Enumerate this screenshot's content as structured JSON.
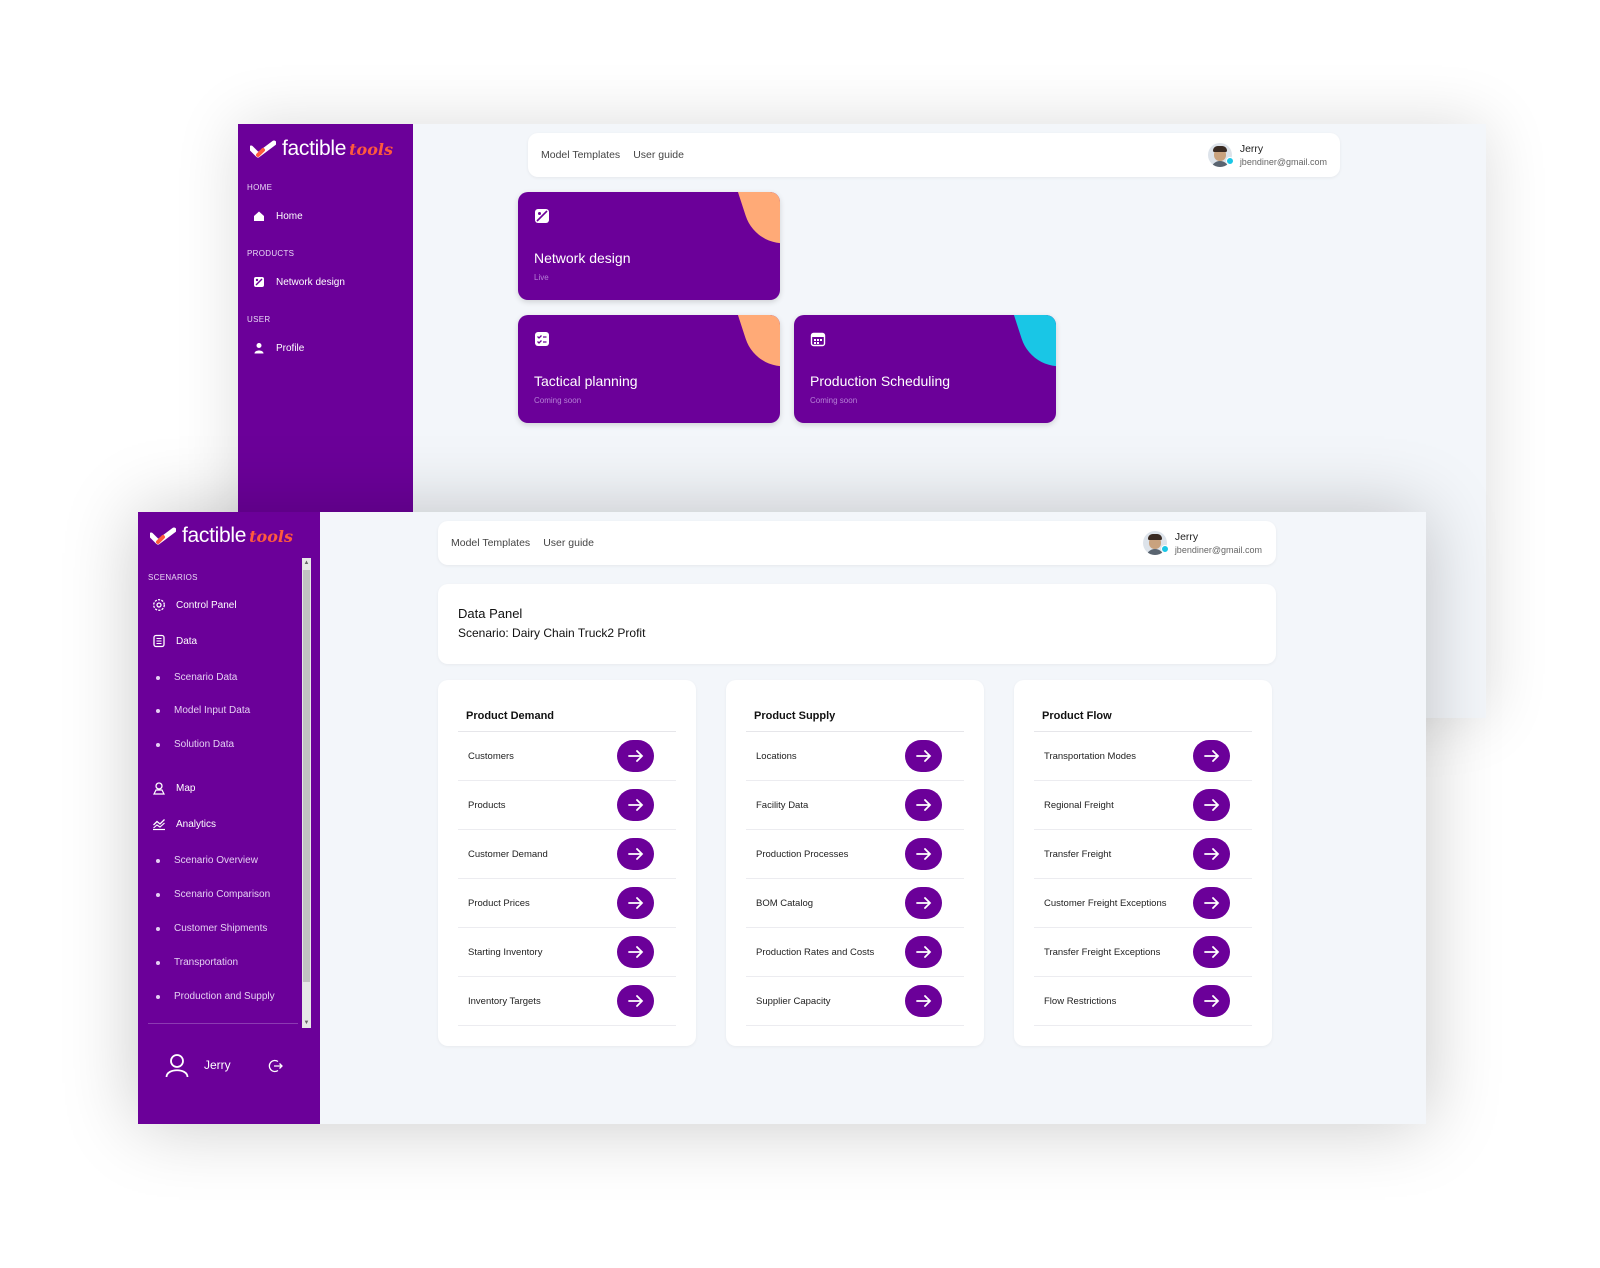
{
  "colors": {
    "purple": "#6b0099",
    "orange_accent": "#ffaa77",
    "cyan_accent": "#19c6e6",
    "logo_tools": "#ff5a3c"
  },
  "brand": {
    "word": "factible",
    "tools": "tools"
  },
  "topbar": {
    "links": [
      "Model Templates",
      "User guide"
    ]
  },
  "user": {
    "name": "Jerry",
    "email": "jbendiner@gmail.com"
  },
  "back": {
    "sections": [
      {
        "label": "HOME",
        "items": [
          {
            "label": "Home",
            "icon": "home-icon"
          }
        ]
      },
      {
        "label": "PRODUCTS",
        "items": [
          {
            "label": "Network design",
            "icon": "network-icon"
          }
        ]
      },
      {
        "label": "USER",
        "items": [
          {
            "label": "Profile",
            "icon": "person-icon"
          }
        ]
      }
    ],
    "cards": [
      {
        "title": "Network design",
        "status": "Live",
        "icon": "image-edit-icon",
        "accent": "orange"
      },
      {
        "title": "Tactical planning",
        "status": "Coming soon",
        "icon": "checklist-icon",
        "accent": "orange"
      },
      {
        "title": "Production Scheduling",
        "status": "Coming soon",
        "icon": "calendar-icon",
        "accent": "cyan"
      }
    ]
  },
  "front": {
    "section_label": "SCENARIOS",
    "nav": [
      {
        "label": "Control Panel",
        "icon": "gear-icon"
      },
      {
        "label": "Data",
        "icon": "database-icon"
      },
      {
        "label": "Scenario Data",
        "sub": true
      },
      {
        "label": "Model Input Data",
        "sub": true
      },
      {
        "label": "Solution Data",
        "sub": true
      },
      {
        "label": "Map",
        "icon": "map-pin-icon"
      },
      {
        "label": "Analytics",
        "icon": "chart-line-icon"
      },
      {
        "label": "Scenario Overview",
        "sub": true
      },
      {
        "label": "Scenario Comparison",
        "sub": true
      },
      {
        "label": "Customer Shipments",
        "sub": true
      },
      {
        "label": "Transportation",
        "sub": true
      },
      {
        "label": "Production and Supply",
        "sub": true
      }
    ],
    "footer_user": "Jerry",
    "panel": {
      "title": "Data Panel",
      "scenario": "Scenario: Dairy Chain Truck2 Profit"
    },
    "columns": [
      {
        "title": "Product Demand",
        "rows": [
          "Customers",
          "Products",
          "Customer Demand",
          "Product Prices",
          "Starting Inventory",
          "Inventory Targets"
        ]
      },
      {
        "title": "Product Supply",
        "rows": [
          "Locations",
          "Facility Data",
          "Production Processes",
          "BOM Catalog",
          "Production Rates and Costs",
          "Supplier Capacity"
        ]
      },
      {
        "title": "Product Flow",
        "rows": [
          "Transportation Modes",
          "Regional Freight",
          "Transfer Freight",
          "Customer Freight Exceptions",
          "Transfer Freight Exceptions",
          "Flow Restrictions"
        ]
      }
    ]
  }
}
